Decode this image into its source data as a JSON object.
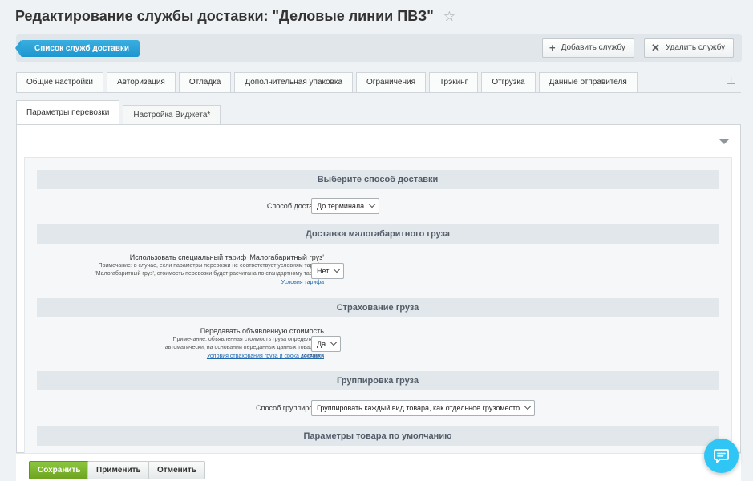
{
  "page": {
    "title": "Редактирование службы доставки: \"Деловые линии ПВЗ\""
  },
  "toolbar": {
    "list_link": "Список служб доставки",
    "add_label": "Добавить службу",
    "delete_label": "Удалить службу"
  },
  "tabs": [
    "Общие настройки",
    "Авторизация",
    "Отладка",
    "Дополнительная упаковка",
    "Ограничения",
    "Трэкинг",
    "Отгрузка",
    "Данные отправителя"
  ],
  "subtabs": {
    "active": "Параметры перевозки",
    "inactive": "Настройка Виджета*"
  },
  "sections": {
    "delivery": {
      "header": "Выберите способ доставки",
      "field_label": "Способ доставки",
      "value": "До терминала"
    },
    "small_cargo": {
      "header": "Доставка малогабаритного груза",
      "field_label": "Использовать специальный тариф 'Малогабаритный груз'",
      "note": "Примечание: в случае, если параметры перевозки не соответствует условиям тарифа 'Малогабаритный груз', стоимость перевозки будет расчитана по стандартному тарифу.",
      "link": "Условия тарифа",
      "value": "Нет"
    },
    "insurance": {
      "header": "Страхование груза",
      "field_label": "Передавать объявленную стоимость",
      "note": "Примечание: объявленная стоимость груза определяется автоматически, на основании переданных данных товарного каталога",
      "link": "Условия страхования груза и срока доставки",
      "value": "Да"
    },
    "grouping": {
      "header": "Группировка груза",
      "field_label": "Способ группировки",
      "value": "Группировать каждый вид товара, как отдельное грузоместо"
    },
    "defaults": {
      "header": "Параметры товара по умолчанию"
    }
  },
  "footer": {
    "save": "Сохранить",
    "apply": "Применить",
    "cancel": "Отменить"
  },
  "colors": {
    "accent_blue": "#1d96cf",
    "save_green": "#6ea420",
    "chat_blue": "#2fc6f6"
  }
}
